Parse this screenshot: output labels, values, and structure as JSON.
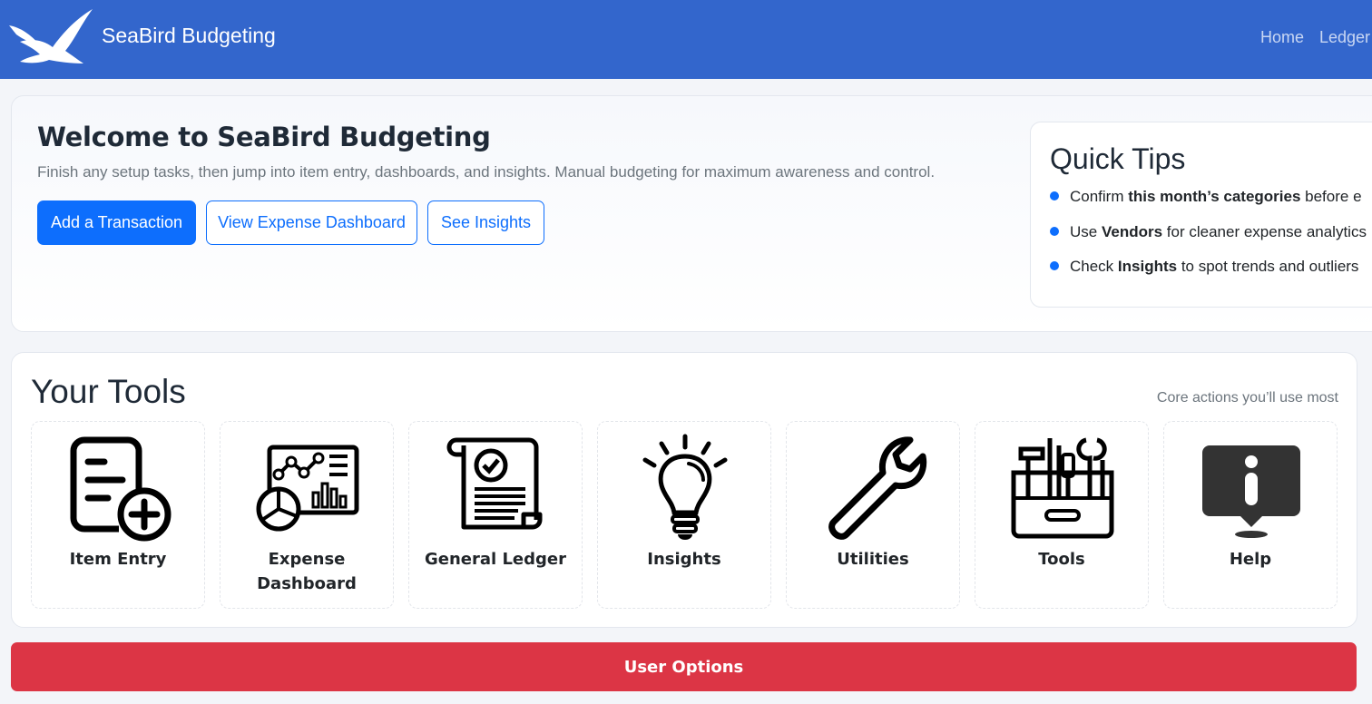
{
  "nav": {
    "brand": "SeaBird Budgeting",
    "links": [
      "Home",
      "Ledger"
    ]
  },
  "hero": {
    "title": "Welcome to SeaBird Budgeting",
    "subtitle": "Finish any setup tasks, then jump into item entry, dashboards, and insights. Manual budgeting for maximum awareness and control.",
    "buttons": {
      "primary": "Add a Transaction",
      "expense": "View Expense Dashboard",
      "insights": "See Insights"
    }
  },
  "tips": {
    "title": "Quick Tips",
    "items": [
      {
        "pre": "Confirm ",
        "bold": "this month’s categories",
        "post": " before e"
      },
      {
        "pre": "Use ",
        "bold": "Vendors",
        "post": " for cleaner expense analytics"
      },
      {
        "pre": "Check ",
        "bold": "Insights",
        "post": " to spot trends and outliers"
      }
    ]
  },
  "tools": {
    "title": "Your Tools",
    "subtitle": "Core actions you’ll use most",
    "cards": [
      {
        "line1": "Item Entry",
        "line2": "",
        "icon": "item-entry-icon"
      },
      {
        "line1": "Expense",
        "line2": "Dashboard",
        "icon": "expense-dashboard-icon"
      },
      {
        "line1": "General Ledger",
        "line2": "",
        "icon": "general-ledger-icon"
      },
      {
        "line1": "Insights",
        "line2": "",
        "icon": "lightbulb-icon"
      },
      {
        "line1": "Utilities",
        "line2": "",
        "icon": "wrench-icon"
      },
      {
        "line1": "Tools",
        "line2": "",
        "icon": "toolbox-icon"
      },
      {
        "line1": "Help",
        "line2": "",
        "icon": "info-icon"
      }
    ]
  },
  "user_options": "User Options",
  "colors": {
    "navbar": "#3366cc",
    "primary": "#0d6efd",
    "danger": "#dc3545"
  }
}
